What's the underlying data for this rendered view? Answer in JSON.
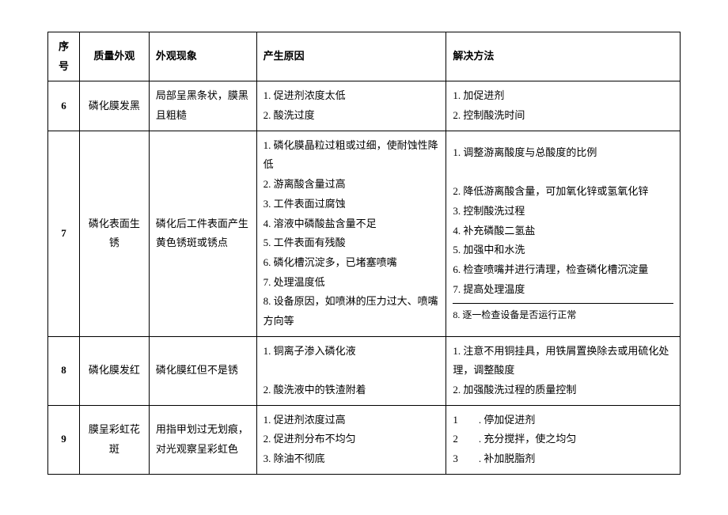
{
  "headers": {
    "seq": "序号",
    "quality": "质量外观",
    "phenomenon": "外观现象",
    "cause": "产生原因",
    "solution": "解决方法"
  },
  "rows": [
    {
      "seq": "6",
      "quality": "磷化膜发黑",
      "phenomenon": "局部呈黑条状，膜黑且粗糙",
      "causes": [
        "1. 促进剂浓度太低",
        "2. 酸洗过度"
      ],
      "solutions": [
        "1. 加促进剂",
        "2. 控制酸洗时间"
      ]
    },
    {
      "seq": "7",
      "quality": "磷化表面生锈",
      "phenomenon": "磷化后工件表面产生黄色锈斑或锈点",
      "causes": [
        "1. 磷化膜晶粒过粗或过细，使耐蚀性降低",
        "2. 游离酸含量过高",
        "3. 工件表面过腐蚀",
        "4. 溶液中磷酸盐含量不足",
        "5. 工件表面有残酸",
        "6. 磷化槽沉淀多，已堵塞喷嘴",
        "7. 处理温度低",
        "8. 设备原因，如喷淋的压力过大、喷嘴方向等"
      ],
      "solutions": [
        "1. 调整游离酸度与总酸度的比例",
        "",
        "2. 降低游离酸含量，可加氧化锌或氢氧化锌",
        "3. 控制酸洗过程",
        "4. 补充磷酸二氢盐",
        "5. 加强中和水洗",
        "6. 检查喷嘴并进行清理，检查磷化槽沉淀量",
        "7. 提高处理温度"
      ],
      "solution_footer": "8. 逐一检查设备是否运行正常"
    },
    {
      "seq": "8",
      "quality": "磷化膜发红",
      "phenomenon": "磷化膜红但不是锈",
      "causes": [
        "1. 铜离子渗入磷化液",
        "",
        "2. 酸洗液中的铁渣附着"
      ],
      "solutions": [
        "1. 注意不用铜挂具，用铁屑置换除去或用硫化处理，调整酸度",
        "2. 加强酸洗过程的质量控制"
      ]
    },
    {
      "seq": "9",
      "quality": "膜呈彩虹花斑",
      "phenomenon": "用指甲划过无划痕，对光观察呈彩虹色",
      "causes": [
        "1. 促进剂浓度过高",
        "2. 促进剂分布不均匀",
        "3. 除油不彻底"
      ],
      "solutions": [
        "1　　. 停加促进剂",
        "2　　. 充分搅拌，使之均匀",
        "3　　. 补加脱脂剂"
      ]
    }
  ]
}
